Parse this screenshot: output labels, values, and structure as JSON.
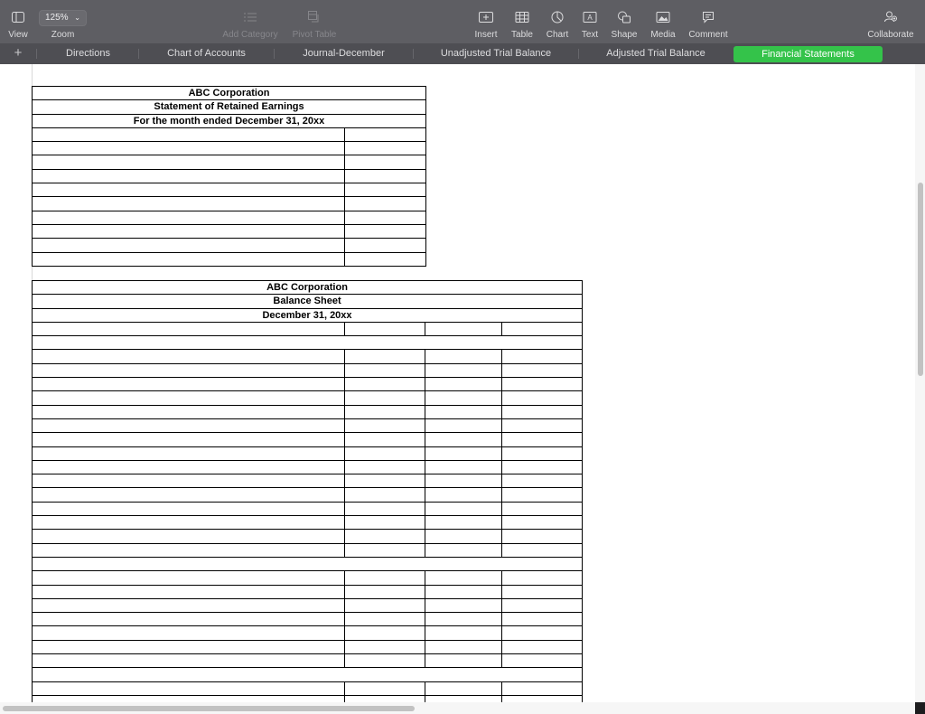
{
  "toolbar": {
    "view": {
      "label": "View",
      "icon": "sidebar-icon"
    },
    "zoom": {
      "label": "Zoom",
      "value": "125%"
    },
    "add_category": {
      "label": "Add Category",
      "icon": "list-icon",
      "enabled": false
    },
    "pivot_table": {
      "label": "Pivot Table",
      "icon": "pivot-table-icon",
      "enabled": false
    },
    "insert": {
      "label": "Insert",
      "icon": "insert-icon"
    },
    "table": {
      "label": "Table",
      "icon": "table-icon"
    },
    "chart": {
      "label": "Chart",
      "icon": "chart-icon"
    },
    "text": {
      "label": "Text",
      "icon": "text-box-icon"
    },
    "shape": {
      "label": "Shape",
      "icon": "shape-icon"
    },
    "media": {
      "label": "Media",
      "icon": "media-icon"
    },
    "comment": {
      "label": "Comment",
      "icon": "comment-icon"
    },
    "collaborate": {
      "label": "Collaborate",
      "icon": "collaborate-icon"
    }
  },
  "sheets": {
    "add_icon": "plus-icon",
    "tabs": [
      {
        "label": "Directions",
        "active": false
      },
      {
        "label": "Chart of Accounts",
        "active": false
      },
      {
        "label": "Journal-December",
        "active": false
      },
      {
        "label": "Unadjusted Trial Balance",
        "active": false
      },
      {
        "label": "Adjusted Trial Balance",
        "active": false
      },
      {
        "label": "Financial Statements",
        "active": true
      }
    ],
    "active_color": "#34c34a"
  },
  "retained_earnings": {
    "company": "ABC Corporation",
    "title": "Statement of Retained Earnings",
    "period": "For the month ended December 31, 20xx",
    "blank_rows": 10
  },
  "balance_sheet": {
    "company": "ABC Corporation",
    "title": "Balance Sheet",
    "date": "December 31, 20xx"
  }
}
